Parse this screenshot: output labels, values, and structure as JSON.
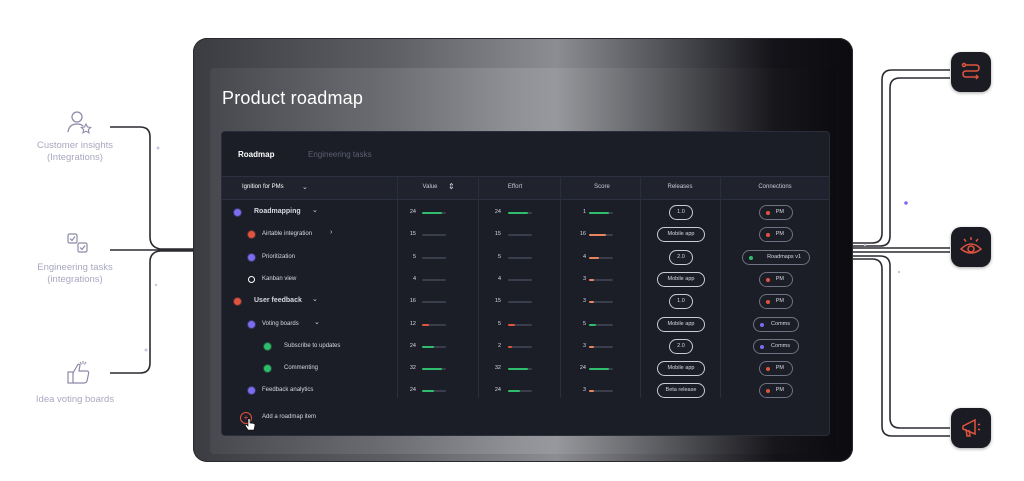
{
  "left_sources": [
    {
      "label": "Customer insights (Integrations)",
      "icon": "user-star-icon"
    },
    {
      "label": "Engineering tasks (integrations)",
      "icon": "checklist-icon"
    },
    {
      "label": "Idea voting boards",
      "icon": "thumbs-up-icon"
    }
  ],
  "right_apps": [
    {
      "icon": "route-icon"
    },
    {
      "icon": "eye-icon"
    },
    {
      "icon": "megaphone-icon"
    }
  ],
  "title": "Product roadmap",
  "tabs": [
    "Roadmap",
    "Engineering tasks"
  ],
  "columns": {
    "name": "Ignition for PMs",
    "value": "Value",
    "effort": "Effort",
    "score": "Score",
    "releases": "Releases",
    "connections": "Connections"
  },
  "rows": [
    {
      "label": "Roadmapping",
      "level": 0,
      "bold": true,
      "icon_color": "#7c6cf0",
      "expand": "down",
      "value": "24",
      "value_fill": 0.85,
      "value_color": "#2ebd6b",
      "effort": "24",
      "effort_fill": 0.85,
      "effort_color": "#2ebd6b",
      "score": "1",
      "score_fill": 0.85,
      "score_color": "#2ebd6b",
      "release": "1.0",
      "conn_label": "PM",
      "conn_dot": "#e0543f"
    },
    {
      "label": "Airtable integration",
      "level": 1,
      "bold": false,
      "icon_color": "#e0543f",
      "expand": "right",
      "value": "15",
      "value_fill": 0,
      "value_color": "#2ebd6b",
      "effort": "15",
      "effort_fill": 0,
      "effort_color": "#2ebd6b",
      "score": "16",
      "score_fill": 0.7,
      "score_color": "#e8845e",
      "release": "Mobile app",
      "conn_label": "PM",
      "conn_dot": "#e0543f"
    },
    {
      "label": "Prioritization",
      "level": 1,
      "bold": false,
      "icon_color": "#7c6cf0",
      "expand": "",
      "value": "5",
      "value_fill": 0,
      "value_color": "#2ebd6b",
      "effort": "5",
      "effort_fill": 0,
      "effort_color": "#2ebd6b",
      "score": "4",
      "score_fill": 0.4,
      "score_color": "#e8845e",
      "release": "2.0",
      "conn_label": "Roadmaps v1",
      "conn_dot": "#2ebd6b"
    },
    {
      "label": "Kanban view",
      "level": 1,
      "bold": false,
      "icon_color": "#ffffff",
      "expand": "",
      "value": "4",
      "value_fill": 0,
      "value_color": "#2ebd6b",
      "effort": "4",
      "effort_fill": 0,
      "effort_color": "#2ebd6b",
      "score": "3",
      "score_fill": 0.2,
      "score_color": "#e8845e",
      "release": "Mobile app",
      "conn_label": "PM",
      "conn_dot": "#e0543f"
    },
    {
      "label": "User feedback",
      "level": 0,
      "bold": true,
      "icon_color": "#e0543f",
      "expand": "down",
      "value": "16",
      "value_fill": 0,
      "value_color": "#2ebd6b",
      "effort": "15",
      "effort_fill": 0,
      "effort_color": "#2ebd6b",
      "score": "3",
      "score_fill": 0.2,
      "score_color": "#e8845e",
      "release": "1.0",
      "conn_label": "PM",
      "conn_dot": "#e0543f"
    },
    {
      "label": "Voting boards",
      "level": 1,
      "bold": false,
      "icon_color": "#7c6cf0",
      "expand": "down",
      "value": "12",
      "value_fill": 0.3,
      "value_color": "#e0543f",
      "effort": "5",
      "effort_fill": 0.3,
      "effort_color": "#e0543f",
      "score": "5",
      "score_fill": 0.3,
      "score_color": "#2ebd6b",
      "release": "Mobile app",
      "conn_label": "Comms",
      "conn_dot": "#7c6cf0"
    },
    {
      "label": "Subscribe to updates",
      "level": 2,
      "bold": false,
      "icon_color": "#2ebd6b",
      "expand": "",
      "value": "24",
      "value_fill": 0.5,
      "value_color": "#2ebd6b",
      "effort": "2",
      "effort_fill": 0.15,
      "effort_color": "#e0543f",
      "score": "3",
      "score_fill": 0.2,
      "score_color": "#e8845e",
      "release": "2.0",
      "conn_label": "Comms",
      "conn_dot": "#7c6cf0"
    },
    {
      "label": "Commenting",
      "level": 2,
      "bold": false,
      "icon_color": "#2ebd6b",
      "expand": "",
      "value": "32",
      "value_fill": 0.85,
      "value_color": "#2ebd6b",
      "effort": "32",
      "effort_fill": 0.85,
      "effort_color": "#2ebd6b",
      "score": "24",
      "score_fill": 0.85,
      "score_color": "#2ebd6b",
      "release": "Mobile app",
      "conn_label": "PM",
      "conn_dot": "#e0543f"
    },
    {
      "label": "Feedback analytics",
      "level": 1,
      "bold": false,
      "icon_color": "#7c6cf0",
      "expand": "",
      "value": "24",
      "value_fill": 0.5,
      "value_color": "#2ebd6b",
      "effort": "24",
      "effort_fill": 0.5,
      "effort_color": "#2ebd6b",
      "score": "3",
      "score_fill": 0.2,
      "score_color": "#e8845e",
      "release": "Beta release",
      "conn_label": "PM",
      "conn_dot": "#e0543f"
    }
  ],
  "add_item": "Add a  roadmap item",
  "colors": {
    "accent_green": "#2ebd6b",
    "accent_red": "#e0543f",
    "accent_purple": "#7c6cf0",
    "card_bg": "#1b1d27"
  }
}
